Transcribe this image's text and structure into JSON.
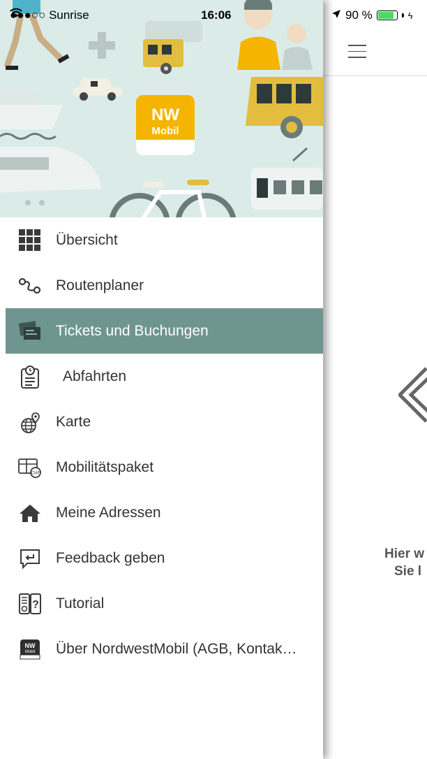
{
  "status_bar": {
    "carrier": "●●●○○ Sunrise",
    "time": "16:06",
    "battery": "90 %"
  },
  "header": {
    "logo_line1": "NW",
    "logo_line2": "Mobil"
  },
  "menu": {
    "items": [
      {
        "label": "Übersicht",
        "icon": "grid-icon"
      },
      {
        "label": "Routenplaner",
        "icon": "route-icon"
      },
      {
        "label": "Tickets und Buchungen",
        "icon": "tickets-icon"
      },
      {
        "label": "Abfahrten",
        "icon": "clipboard-clock-icon"
      },
      {
        "label": "Karte",
        "icon": "globe-pin-icon"
      },
      {
        "label": "Mobilitätspaket",
        "icon": "mobility-package-icon"
      },
      {
        "label": "Meine Adressen",
        "icon": "home-icon"
      },
      {
        "label": "Feedback geben",
        "icon": "feedback-icon"
      },
      {
        "label": "Tutorial",
        "icon": "tutorial-icon"
      },
      {
        "label": "Über NordwestMobil (AGB, Kontak…",
        "icon": "nw-mobil-icon"
      }
    ],
    "active_index": 2
  },
  "main": {
    "empty_line1": "Hier w",
    "empty_line2": "Sie l"
  },
  "colors": {
    "active_bg": "#6f9591",
    "header_bg": "#dbece8",
    "logo_yellow": "#f4b400"
  }
}
